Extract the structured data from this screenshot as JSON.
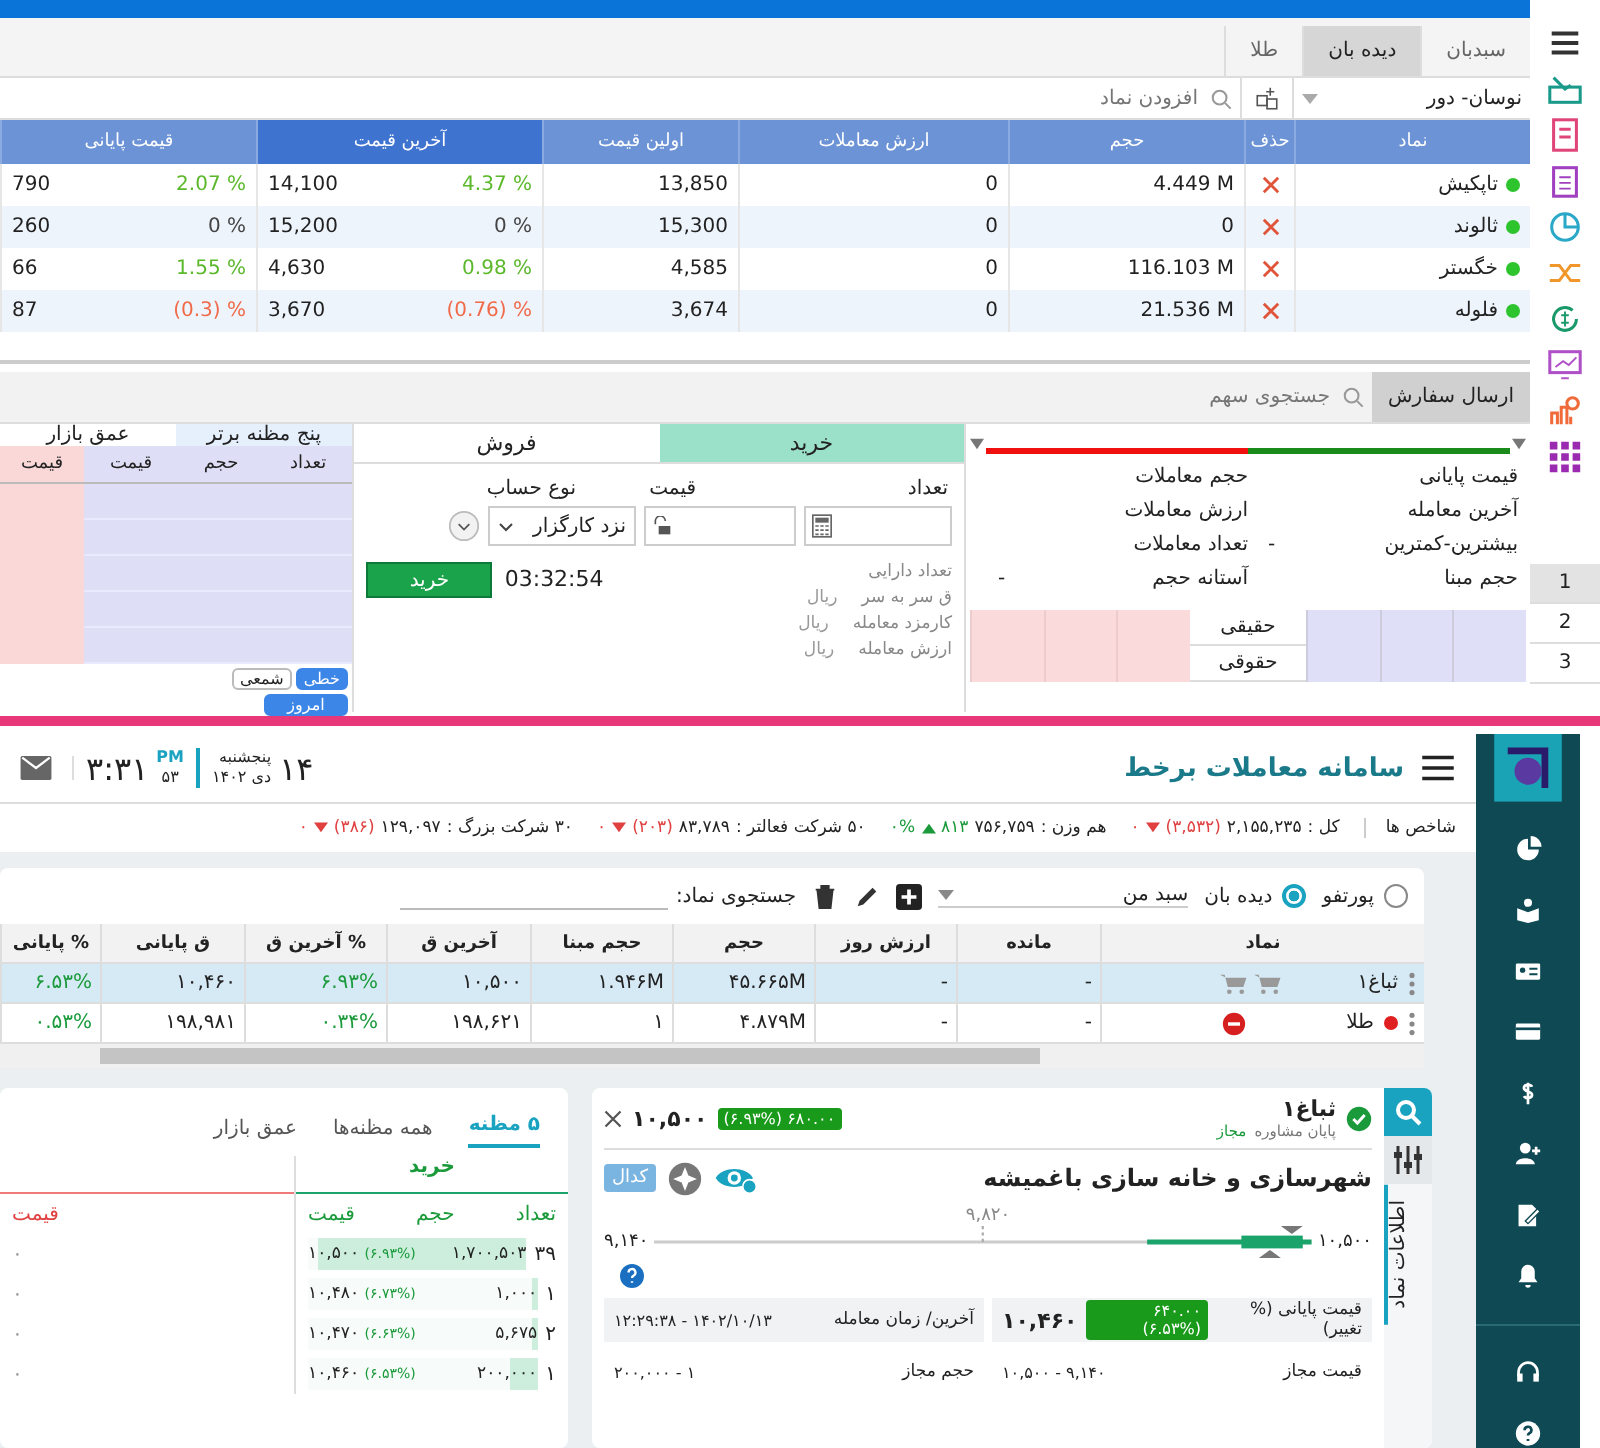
{
  "top": {
    "tabs": [
      {
        "label": "سبدبان",
        "selected": false
      },
      {
        "label": "دیده بان",
        "selected": true
      },
      {
        "label": "طلا",
        "selected": false
      }
    ],
    "list_select": {
      "value": "نوسان- دور"
    },
    "symbol_search": {
      "placeholder": "افزودن نماد"
    },
    "table": {
      "columns": [
        {
          "label": "نماد",
          "sorted": false
        },
        {
          "label": "حذف",
          "sorted": false
        },
        {
          "label": "حجم",
          "sorted": false
        },
        {
          "label": "ارزش معاملات",
          "sorted": false
        },
        {
          "label": "اولین قیمت",
          "sorted": false
        },
        {
          "label": "آخرین قیمت",
          "sorted": true
        },
        {
          "label": "قیمت پایانی",
          "sorted": false
        }
      ],
      "rows": [
        {
          "symbol": "تاپکیش",
          "volume": "4.449 M",
          "value": "0",
          "first": "13,850",
          "last": "14,100",
          "last_change": {
            "text": "4.37 %",
            "color": "#5ab82a"
          },
          "final": "790",
          "final_change": {
            "text": "2.07 %",
            "color": "#5ab82a"
          }
        },
        {
          "symbol": "ثالوند",
          "volume": "0",
          "value": "0",
          "first": "15,300",
          "last": "15,200",
          "last_change": {
            "text": "0 %",
            "color": "#444444"
          },
          "final": "260",
          "final_change": {
            "text": "0 %",
            "color": "#444444"
          }
        },
        {
          "symbol": "خگستر",
          "volume": "116.103 M",
          "value": "0",
          "first": "4,585",
          "last": "4,630",
          "last_change": {
            "text": "0.98 %",
            "color": "#5ab82a"
          },
          "final": "66",
          "final_change": {
            "text": "1.55 %",
            "color": "#5ab82a"
          }
        },
        {
          "symbol": "فلوله",
          "volume": "21.536 M",
          "value": "0",
          "first": "3,674",
          "last": "3,670",
          "last_change": {
            "text": "(0.76) %",
            "color": "#f06a4a"
          },
          "final": "87",
          "final_change": {
            "text": "(0.3) %",
            "color": "#f06a4a"
          }
        }
      ]
    },
    "order_tab": "ارسال سفارش",
    "stock_search": {
      "placeholder": "جستجوی سهم"
    },
    "summary": {
      "buy_share": {
        "level": 0.5
      },
      "right": [
        {
          "label": "قیمت پایانی"
        },
        {
          "label": "آخرین معامله"
        },
        {
          "label": "بیشترین-کمترین",
          "value": "-"
        },
        {
          "label": "حجم مبنا"
        }
      ],
      "left": [
        {
          "label": "حجم معاملات"
        },
        {
          "label": "ارزش معاملات"
        },
        {
          "label": "تعداد معاملات"
        },
        {
          "label": "آستانه حجم",
          "value": "-"
        }
      ],
      "holders": [
        "حقیقی",
        "حقوقی"
      ]
    },
    "order": {
      "sides": [
        {
          "label": "خرید",
          "selected": true
        },
        {
          "label": "فروش",
          "selected": false
        }
      ],
      "field_labels": [
        "تعداد",
        "قیمت",
        "نوع حساب"
      ],
      "account": "نزد کارگزار",
      "submit": "خرید",
      "timer": "03:32:54",
      "info": [
        {
          "label": "تعداد دارایی"
        },
        {
          "label": "ق سر به سر",
          "unit": "ریال"
        },
        {
          "label": "کارمزد معامله",
          "unit": "ریال"
        },
        {
          "label": "ارزش معامله",
          "unit": "ریال"
        }
      ]
    },
    "depth": {
      "tabs": [
        {
          "label": "پنج مظنه برتر",
          "selected": true
        },
        {
          "label": "عمق بازار",
          "selected": false
        }
      ],
      "columns": [
        "تعداد",
        "حجم",
        "قیمت"
      ],
      "sell_column": "قیمت",
      "chart_types": [
        {
          "label": "خطی",
          "selected": true
        },
        {
          "label": "شمعی",
          "selected": false
        }
      ],
      "range": "امروز"
    },
    "pages": [
      {
        "label": "1",
        "selected": true
      },
      {
        "label": "2",
        "selected": false
      },
      {
        "label": "3",
        "selected": false
      }
    ]
  },
  "bottom": {
    "title": "سامانه معاملات برخط",
    "date": {
      "day": "۱۴",
      "weekday": "پنجشنبه",
      "month": "دی ۱۴۰۲"
    },
    "clock": {
      "time": "۳:۳۱",
      "period": "PM",
      "seconds": "۵۳"
    },
    "indices_label": "شاخص ها",
    "indices": [
      {
        "label": "کل :",
        "value": "۲,۱۵۵,۲۳۵",
        "change": "(۳,۵۳۲)",
        "rising": false,
        "tail": "۰"
      },
      {
        "label": "هم وزن :",
        "value": "۷۵۶,۷۵۹",
        "change": "۸۱۳",
        "rising": true,
        "tail": "۰%"
      },
      {
        "label": "۵۰ شرکت فعالتر :",
        "value": "۸۳,۷۸۹",
        "change": "(۲۰۳)",
        "rising": false,
        "tail": "۰"
      },
      {
        "label": "۳۰ شرکت بزرگ :",
        "value": "۱۲۹,۰۹۷",
        "change": "(۳۸۶)",
        "rising": false,
        "tail": "۰"
      }
    ],
    "views": [
      {
        "label": "پورتفو",
        "selected": false
      },
      {
        "label": "دیده بان",
        "selected": true
      }
    ],
    "basket": {
      "value": "سبد من"
    },
    "symbol_search": {
      "label": "جستجوی نماد:"
    },
    "table": {
      "columns": [
        "نماد",
        "مانده",
        "ارزش روز",
        "حجم",
        "حجم مبنا",
        "آخرین ق",
        "% آخرین ق",
        "ق پایانی",
        "% پایانی"
      ],
      "rows": [
        {
          "flagged": false,
          "kind": "cart",
          "selected": true,
          "cells": [
            "ثباغ۱",
            "-",
            "-",
            "۴۵.۶۶۵M",
            "۱.۹۴۶M",
            "۱۰,۵۰۰",
            "۶.۹۳%",
            "۱۰,۴۶۰",
            "۶.۵۳%"
          ]
        },
        {
          "flagged": true,
          "kind": "remove",
          "selected": false,
          "cells": [
            "طلا",
            "-",
            "-",
            "۴.۸۷۹M",
            "۱",
            "۱۹۸,۶۲۱",
            "۰.۳۴%",
            "۱۹۸,۹۸۱",
            "۰.۵۳%"
          ]
        }
      ]
    },
    "symbol": {
      "name": "ثباغ۱",
      "verified": true,
      "status": "پایان مشاوره",
      "permission": "مجاز",
      "change": "۶۸۰.۰۰ (۶.۹۳%)",
      "price": "۱۰,۵۰۰",
      "company": "شهرسازی و خانه سازی باغمیشه",
      "codal": "کدال",
      "side_tab": "اطلاعات نماد",
      "range": {
        "low": "۹,۱۴۰",
        "mid": "۹,۸۲۰",
        "high": "۱۰,۵۰۰"
      },
      "stats": [
        {
          "label": "قیمت پایانی (% تغییر)",
          "badge": "۶۴۰.۰۰ (۶.۵۳%)",
          "value": "۱۰,۴۶۰"
        },
        {
          "label": "آخرین/ زمان معامله",
          "value": "۱۴۰۲/۱۰/۱۳ - ۱۲:۲۹:۳۸"
        },
        {
          "label": "قیمت مجاز",
          "value": "۹,۱۴۰ - ۱۰,۵۰۰"
        },
        {
          "label": "حجم مجاز",
          "value": "۱ - ۲۰۰,۰۰۰"
        }
      ]
    },
    "book": {
      "tabs": [
        {
          "label": "۵ مظنه",
          "selected": true
        },
        {
          "label": "همه مظنه‌ها",
          "selected": false
        },
        {
          "label": "عمق بازار",
          "selected": false
        }
      ],
      "buy_title": "خرید",
      "columns": [
        "تعداد",
        "حجم",
        "قیمت"
      ],
      "sell_column": "قیمت",
      "rows": [
        {
          "count": "۳۹",
          "volume": "۱,۷۰۰,۵۰۳",
          "price": "۱۰,۵۰۰",
          "change": "(۶.۹۳%)",
          "sell": "۰",
          "level": 0.95
        },
        {
          "count": "۱",
          "volume": "۱,۰۰۰",
          "price": "۱۰,۴۸۰",
          "change": "(۶.۷۳%)",
          "sell": "۰",
          "level": 0.02
        },
        {
          "count": "۲",
          "volume": "۵,۶۷۵",
          "price": "۱۰,۴۷۰",
          "change": "(۶.۶۳%)",
          "sell": "۰",
          "level": 0.02
        },
        {
          "count": "۱",
          "volume": "۲۰۰,۰۰۰",
          "price": "۱۰,۴۶۰",
          "change": "(۶.۵۳%)",
          "sell": "۰",
          "level": 0.12
        }
      ]
    }
  }
}
